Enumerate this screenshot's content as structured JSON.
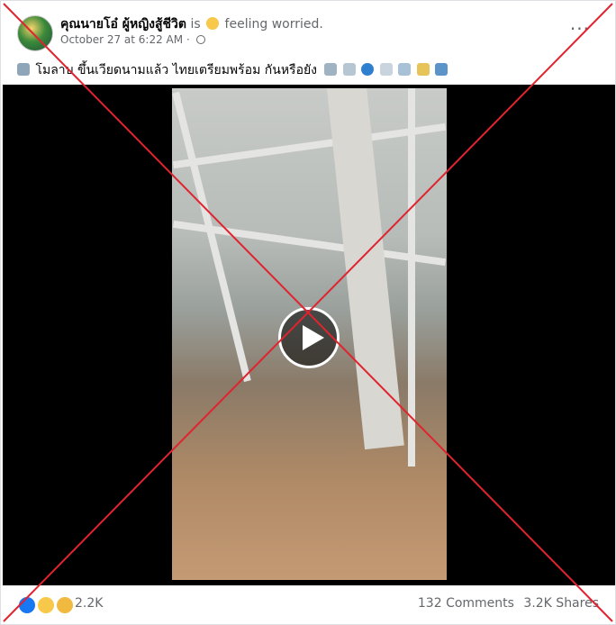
{
  "post": {
    "author": "คุณนายโอ๋ ผู้หญิงสู้ชีวิต",
    "status_prefix": "is",
    "status_text": "feeling worried.",
    "timestamp": "October 27 at 6:22 AM",
    "separator": "·",
    "more_label": "···",
    "caption": "โมลาบ ขึ้นเวียดนามแล้ว ไทยเตรียมพร้อม กันหรือยัง"
  },
  "reactions": {
    "count": "2.2K",
    "types": [
      "like",
      "wow",
      "sad"
    ]
  },
  "engagement": {
    "comments": "132 Comments",
    "shares": "3.2K Shares"
  },
  "colors": {
    "x_overlay": "#e0242f",
    "play_bg": "#000000"
  },
  "icons": [
    "avatar",
    "feeling-worried-icon",
    "globe-icon",
    "more-icon",
    "tornado-icon",
    "weather-icons",
    "play-icon",
    "like-reaction-icon",
    "wow-reaction-icon",
    "sad-reaction-icon"
  ]
}
